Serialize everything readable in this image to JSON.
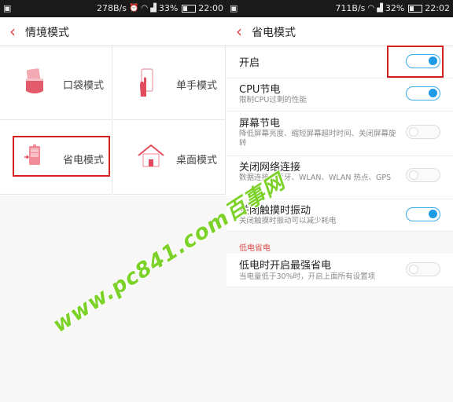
{
  "left": {
    "status": {
      "speed": "278B/s",
      "battery": "33%",
      "time": "22:00",
      "battery_level": 0.33
    },
    "title": "情境模式",
    "modes": [
      {
        "label": "口袋模式"
      },
      {
        "label": "单手模式"
      },
      {
        "label": "省电模式"
      },
      {
        "label": "桌面模式"
      }
    ]
  },
  "right": {
    "status": {
      "speed": "711B/s",
      "battery": "32%",
      "time": "22:02",
      "battery_level": 0.32
    },
    "title": "省电模式",
    "settings": [
      {
        "title": "开启",
        "subtitle": "",
        "on": true
      },
      {
        "title": "CPU节电",
        "subtitle": "限制CPU过剩的性能",
        "on": true
      },
      {
        "title": "屏幕节电",
        "subtitle": "降低屏幕亮度、缩短屏幕超时时间、关闭屏幕旋转",
        "on": false
      },
      {
        "title": "关闭网络连接",
        "subtitle": "数据连接、蓝牙、WLAN、WLAN 热点、GPS",
        "on": false
      },
      {
        "title": "关闭触摸时振动",
        "subtitle": "关闭触摸时振动可以减少耗电",
        "on": true
      }
    ],
    "section": "低电省电",
    "low_battery": {
      "title": "低电时开启最强省电",
      "subtitle": "当电量低于30%时，开启上面所有设置项",
      "on": false
    }
  },
  "watermark": "www.pc841.com百事网",
  "colors": {
    "accent": "#e04040",
    "toggle_on": "#1e9be6",
    "highlight": "#d32020",
    "watermark": "#7dd22a"
  }
}
